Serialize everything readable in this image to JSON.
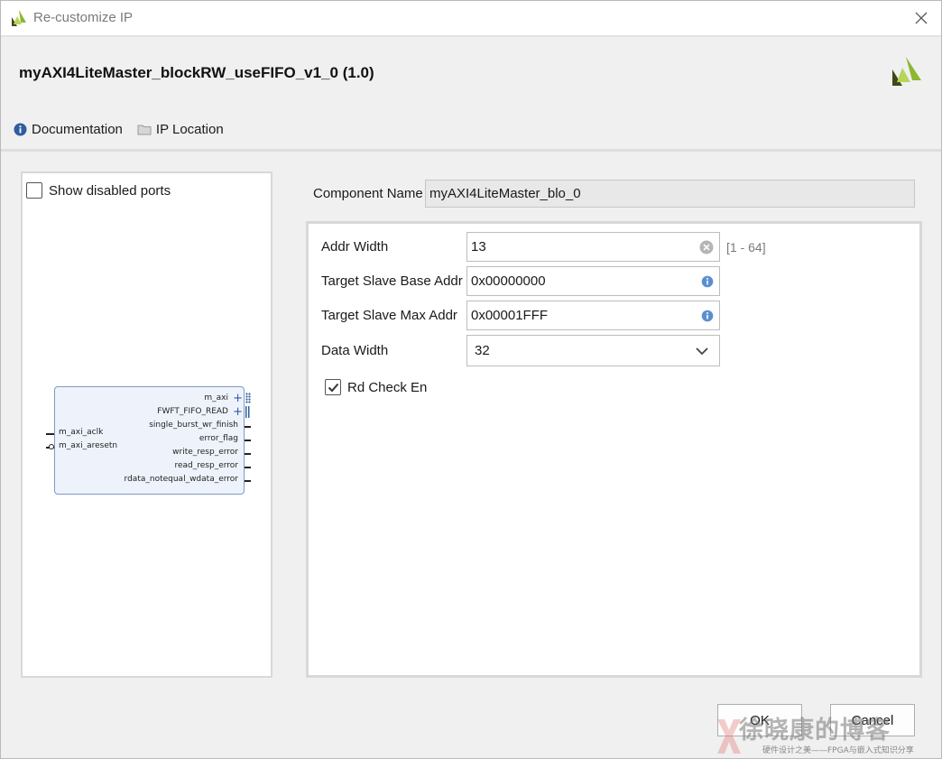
{
  "window": {
    "title": "Re-customize IP",
    "close_icon": "close-icon",
    "colors": {
      "logo_green": "#8cb82f",
      "logo_dark": "#3c4a18",
      "accent_blue": "#2e5e9e"
    }
  },
  "header": {
    "ip_title": "myAXI4LiteMaster_blockRW_useFIFO_v1_0 (1.0)",
    "links": [
      {
        "label": "Documentation",
        "icon": "info-icon"
      },
      {
        "label": "IP Location",
        "icon": "folder-icon"
      }
    ]
  },
  "left_panel": {
    "show_disabled_label": "Show disabled ports",
    "show_disabled_checked": false,
    "block": {
      "inputs": [
        "m_axi_aclk",
        "m_axi_aresetn"
      ],
      "outputs": [
        "m_axi",
        "FWFT_FIFO_READ",
        "single_burst_wr_finish",
        "error_flag",
        "write_resp_error",
        "read_resp_error",
        "rdata_notequal_wdata_error"
      ]
    }
  },
  "component": {
    "label": "Component Name",
    "value": "myAXI4LiteMaster_blo_0"
  },
  "params": {
    "addr_width": {
      "label": "Addr Width",
      "value": "13",
      "range": "[1 - 64]"
    },
    "base_addr": {
      "label": "Target Slave Base Addr",
      "value": "0x00000000"
    },
    "max_addr": {
      "label": "Target Slave Max Addr",
      "value": "0x00001FFF"
    },
    "data_width": {
      "label": "Data Width",
      "value": "32"
    },
    "rd_check": {
      "label": "Rd Check En",
      "checked": true
    }
  },
  "footer": {
    "ok_label": "OK",
    "cancel_label": "Cancel"
  },
  "watermark": {
    "main": "徐晓康的博客",
    "sub": "硬件设计之美——FPGA与嵌入式知识分享"
  }
}
